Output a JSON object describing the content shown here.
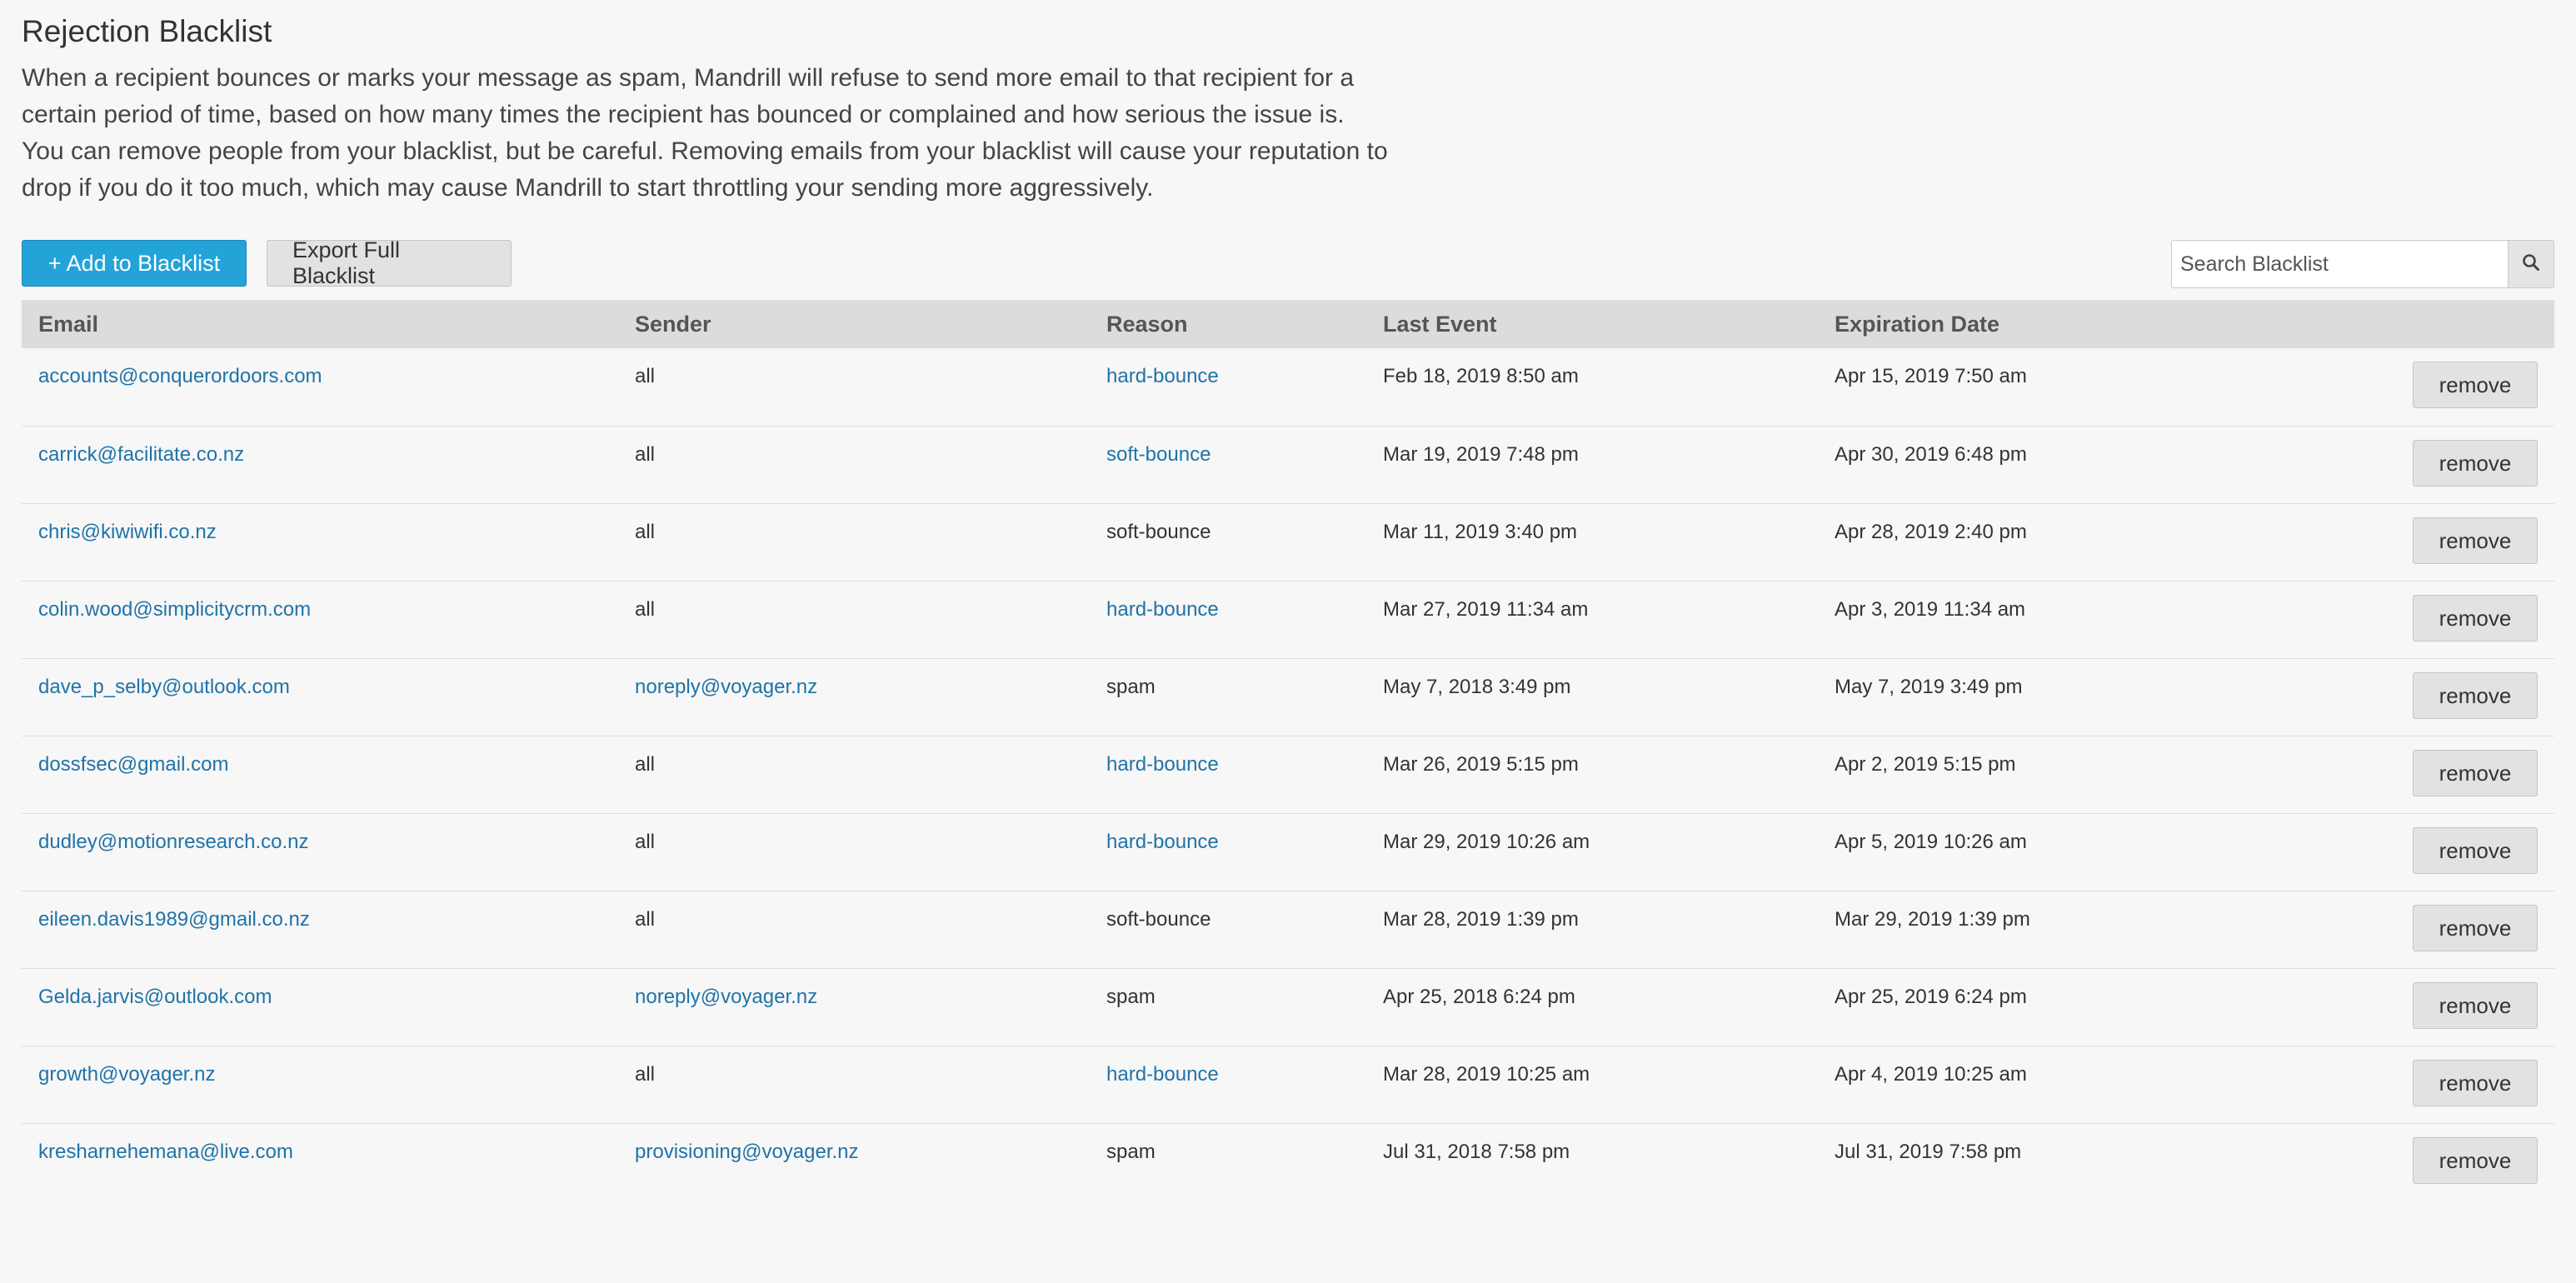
{
  "page": {
    "title": "Rejection Blacklist",
    "description": "When a recipient bounces or marks your message as spam, Mandrill will refuse to send more email to that recipient for a certain period of time, based on how many times the recipient has bounced or complained and how serious the issue is. You can remove people from your blacklist, but be careful. Removing emails from your blacklist will cause your reputation to drop if you do it too much, which may cause Mandrill to start throttling your sending more aggressively."
  },
  "toolbar": {
    "add_label": "+ Add to Blacklist",
    "export_label": "Export Full Blacklist",
    "search_placeholder": "Search Blacklist",
    "search_icon": "search-icon"
  },
  "colors": {
    "primary": "#24a3d8",
    "link": "#1f73a8",
    "header_bg": "#dcdcdc",
    "page_bg": "#f7f7f7"
  },
  "table": {
    "headers": [
      "Email",
      "Sender",
      "Reason",
      "Last Event",
      "Expiration Date"
    ],
    "remove_label": "remove",
    "rows": [
      {
        "email": "accounts@conquerordoors.com",
        "sender": "all",
        "sender_link": false,
        "reason": "hard-bounce",
        "reason_link": true,
        "last_event": "Feb 18, 2019 8:50 am",
        "expiration": "Apr 15, 2019 7:50 am"
      },
      {
        "email": "carrick@facilitate.co.nz",
        "sender": "all",
        "sender_link": false,
        "reason": "soft-bounce",
        "reason_link": true,
        "last_event": "Mar 19, 2019 7:48 pm",
        "expiration": "Apr 30, 2019 6:48 pm"
      },
      {
        "email": "chris@kiwiwifi.co.nz",
        "sender": "all",
        "sender_link": false,
        "reason": "soft-bounce",
        "reason_link": false,
        "last_event": "Mar 11, 2019 3:40 pm",
        "expiration": "Apr 28, 2019 2:40 pm"
      },
      {
        "email": "colin.wood@simplicitycrm.com",
        "sender": "all",
        "sender_link": false,
        "reason": "hard-bounce",
        "reason_link": true,
        "last_event": "Mar 27, 2019 11:34 am",
        "expiration": "Apr 3, 2019 11:34 am"
      },
      {
        "email": "dave_p_selby@outlook.com",
        "sender": "noreply@voyager.nz",
        "sender_link": true,
        "reason": "spam",
        "reason_link": false,
        "last_event": "May 7, 2018 3:49 pm",
        "expiration": "May 7, 2019 3:49 pm"
      },
      {
        "email": "dossfsec@gmail.com",
        "sender": "all",
        "sender_link": false,
        "reason": "hard-bounce",
        "reason_link": true,
        "last_event": "Mar 26, 2019 5:15 pm",
        "expiration": "Apr 2, 2019 5:15 pm"
      },
      {
        "email": "dudley@motionresearch.co.nz",
        "sender": "all",
        "sender_link": false,
        "reason": "hard-bounce",
        "reason_link": true,
        "last_event": "Mar 29, 2019 10:26 am",
        "expiration": "Apr 5, 2019 10:26 am"
      },
      {
        "email": "eileen.davis1989@gmail.co.nz",
        "sender": "all",
        "sender_link": false,
        "reason": "soft-bounce",
        "reason_link": false,
        "last_event": "Mar 28, 2019 1:39 pm",
        "expiration": "Mar 29, 2019 1:39 pm"
      },
      {
        "email": "Gelda.jarvis@outlook.com",
        "sender": "noreply@voyager.nz",
        "sender_link": true,
        "reason": "spam",
        "reason_link": false,
        "last_event": "Apr 25, 2018 6:24 pm",
        "expiration": "Apr 25, 2019 6:24 pm"
      },
      {
        "email": "growth@voyager.nz",
        "sender": "all",
        "sender_link": false,
        "reason": "hard-bounce",
        "reason_link": true,
        "last_event": "Mar 28, 2019 10:25 am",
        "expiration": "Apr 4, 2019 10:25 am"
      },
      {
        "email": "kresharnehemana@live.com",
        "sender": "provisioning@voyager.nz",
        "sender_link": true,
        "reason": "spam",
        "reason_link": false,
        "last_event": "Jul 31, 2018 7:58 pm",
        "expiration": "Jul 31, 2019 7:58 pm"
      }
    ]
  }
}
